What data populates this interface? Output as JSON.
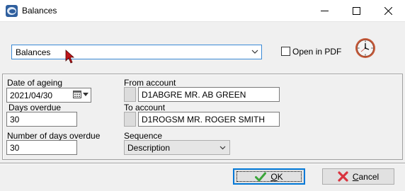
{
  "window": {
    "title": "Balances",
    "icon": "app-icon",
    "controls": [
      "minimize-icon",
      "maximize-icon",
      "close-icon"
    ]
  },
  "report": {
    "selected": "Balances",
    "open_in_pdf_label": "Open in PDF",
    "open_in_pdf_checked": false,
    "clock_icon": "clock-icon"
  },
  "form": {
    "date_of_ageing": {
      "label": "Date of ageing",
      "value": "2021/04/30"
    },
    "days_overdue": {
      "label": "Days overdue",
      "value": "30"
    },
    "number_days_overdue": {
      "label": "Number of days overdue",
      "value": "30"
    },
    "from_account": {
      "label": "From account",
      "value": "D1ABGRE MR. AB GREEN"
    },
    "to_account": {
      "label": "To account",
      "value": "D1ROGSM MR. ROGER SMITH"
    },
    "sequence": {
      "label": "Sequence",
      "value": "Description"
    }
  },
  "buttons": {
    "ok_label": "OK",
    "cancel_label": "Cancel"
  },
  "colors": {
    "accent": "#0078d7",
    "ok_check": "#3aa53a",
    "cancel_x": "#d9343f",
    "clock_rim": "#c0392b"
  }
}
